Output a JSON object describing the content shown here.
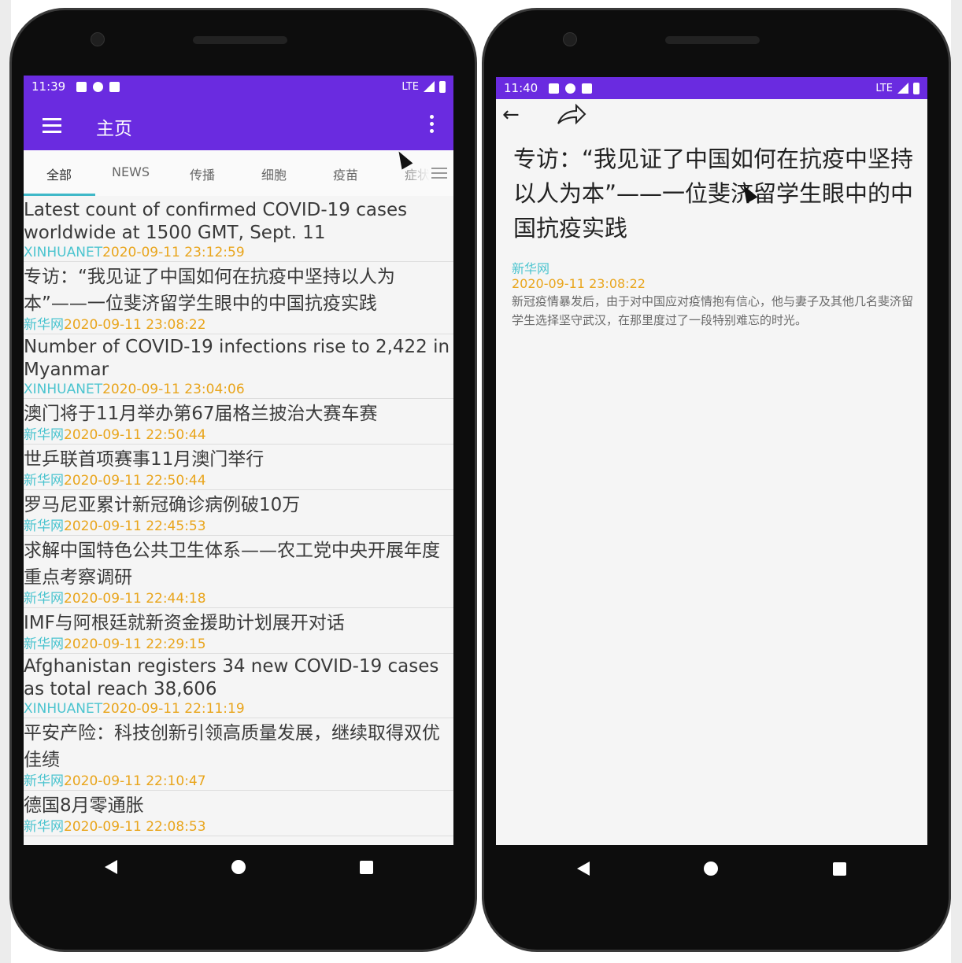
{
  "left_phone": {
    "status": {
      "time": "11:39",
      "network": "LTE"
    },
    "appbar": {
      "title": "主页"
    },
    "tabs": [
      "全部",
      "NEWS",
      "传播",
      "细胞",
      "疫苗",
      "症状"
    ],
    "news": [
      {
        "title": "Latest count of confirmed COVID-19 cases worldwide at 1500 GMT, Sept. 11",
        "source": "XINHUANET",
        "date": "2020-09-11 23:12:59",
        "zh": false
      },
      {
        "title": "专访：“我见证了中国如何在抗疫中坚持以人为本”——一位斐济留学生眼中的中国抗疫实践",
        "source": "新华网",
        "date": "2020-09-11 23:08:22",
        "zh": true
      },
      {
        "title": "Number of COVID-19 infections rise to 2,422 in Myanmar",
        "source": "XINHUANET",
        "date": "2020-09-11 23:04:06",
        "zh": false
      },
      {
        "title": "澳门将于11月举办第67届格兰披治大赛车赛",
        "source": "新华网",
        "date": "2020-09-11 22:50:44",
        "zh": true
      },
      {
        "title": "世乒联首项赛事11月澳门举行",
        "source": "新华网",
        "date": "2020-09-11 22:50:44",
        "zh": true
      },
      {
        "title": "罗马尼亚累计新冠确诊病例破10万",
        "source": "新华网",
        "date": "2020-09-11 22:45:53",
        "zh": true
      },
      {
        "title": "求解中国特色公共卫生体系——农工党中央开展年度重点考察调研",
        "source": "新华网",
        "date": "2020-09-11 22:44:18",
        "zh": true
      },
      {
        "title": "IMF与阿根廷就新资金援助计划展开对话",
        "source": "新华网",
        "date": "2020-09-11 22:29:15",
        "zh": true
      },
      {
        "title": "Afghanistan registers 34 new COVID-19 cases as total reach 38,606",
        "source": "XINHUANET",
        "date": "2020-09-11 22:11:19",
        "zh": false
      },
      {
        "title": "平安产险：科技创新引领高质量发展，继续取得双优佳绩",
        "source": "新华网",
        "date": "2020-09-11 22:10:47",
        "zh": true
      },
      {
        "title": "德国8月零通胀",
        "source": "新华网",
        "date": "2020-09-11 22:08:53",
        "zh": true
      }
    ]
  },
  "right_phone": {
    "status": {
      "time": "11:40",
      "network": "LTE"
    },
    "article": {
      "title": "专访：“我见证了中国如何在抗疫中坚持以人为本”——一位斐济留学生眼中的中国抗疫实践",
      "source": "新华网",
      "date": "2020-09-11 23:08:22",
      "body": "新冠疫情暴发后，由于对中国应对疫情抱有信心，他与妻子及其他几名斐济留学生选择坚守武汉，在那里度过了一段特别难忘的时光。"
    }
  },
  "colors": {
    "accent": "#6a2be0",
    "source": "#4bc4cf",
    "date": "#e9a51c"
  }
}
